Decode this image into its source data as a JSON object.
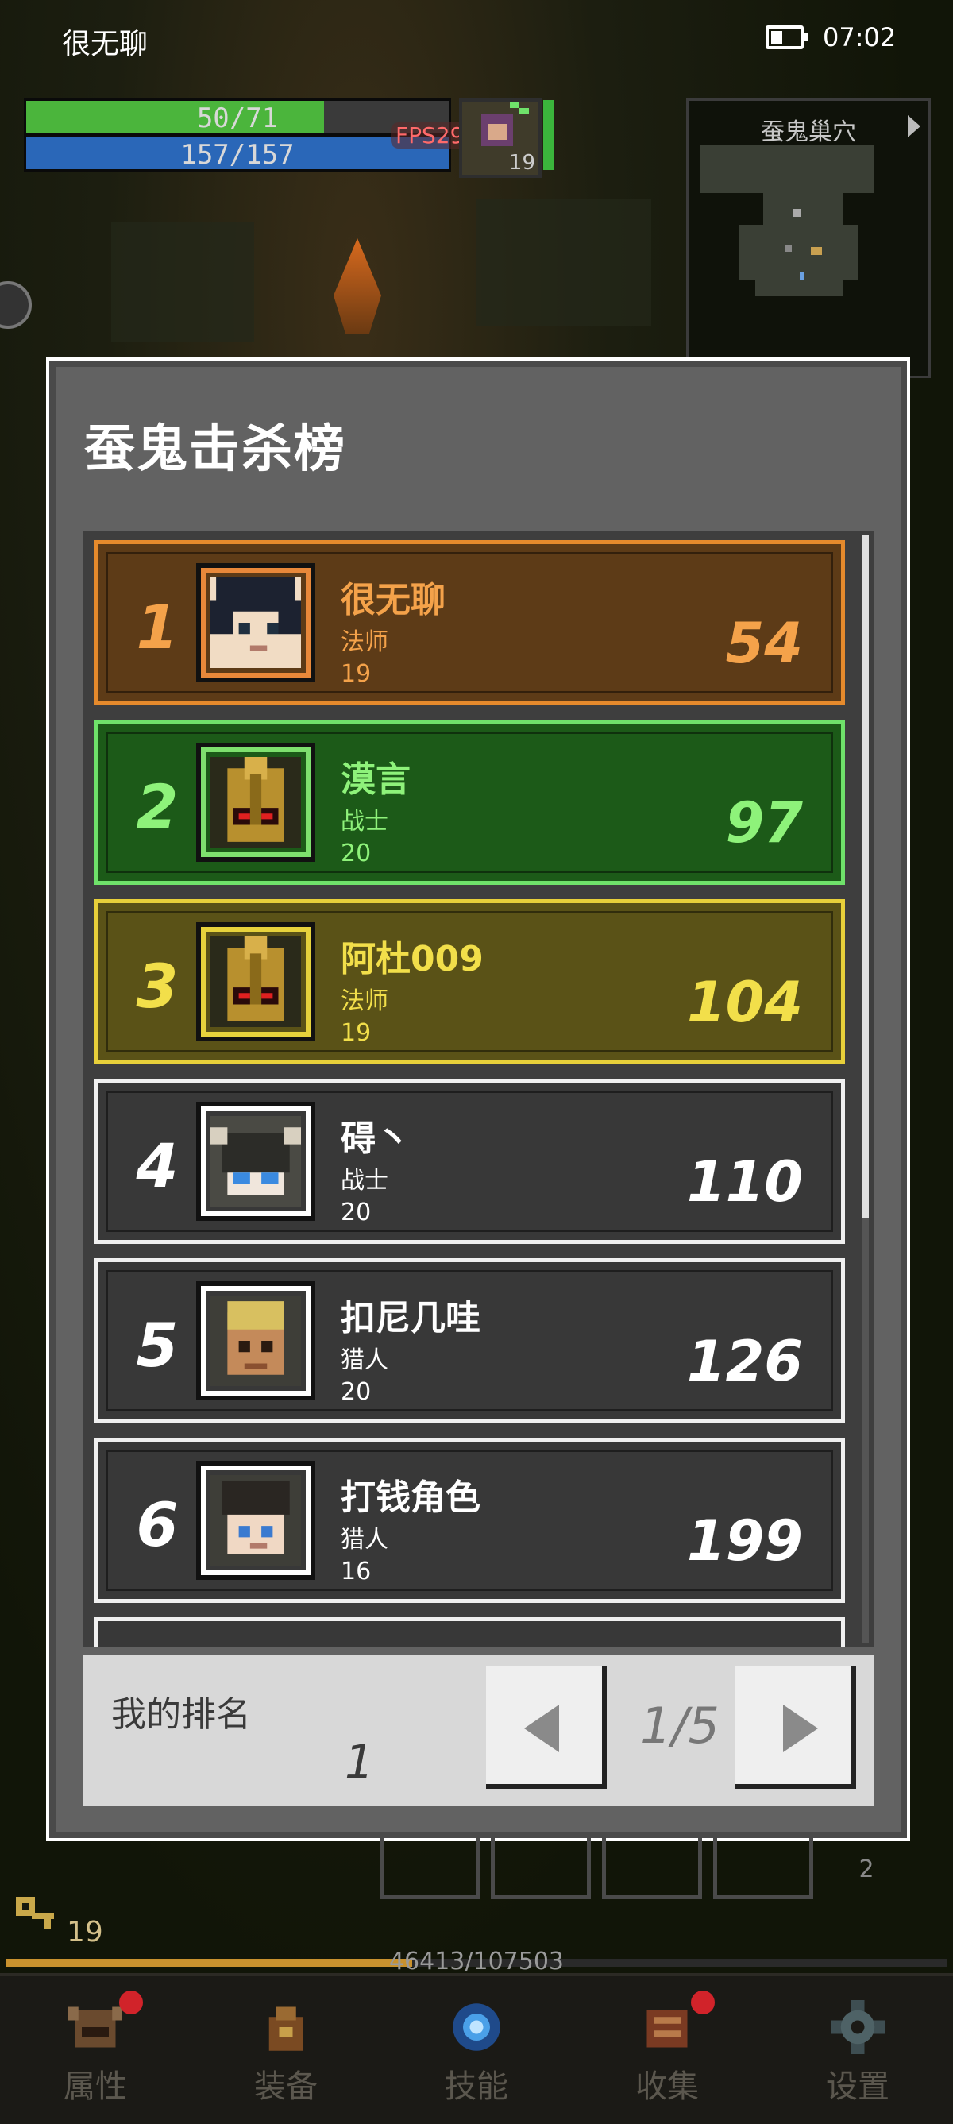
{
  "status_bar": {
    "title": "很无聊",
    "time": "07:02"
  },
  "hud": {
    "hp_text": "50/71",
    "hp_fraction": 0.704,
    "mp_text": "157/157",
    "fps_text": "FPS29",
    "pet_level": "19",
    "minimap_title": "蚕鬼巢穴"
  },
  "modal": {
    "title": "蚕鬼击杀榜",
    "rows": [
      {
        "rank": "1",
        "name": "很无聊",
        "class": "法师",
        "level": "19",
        "kills": "54",
        "avatar": "mage-boy"
      },
      {
        "rank": "2",
        "name": "漠言",
        "class": "战士",
        "level": "20",
        "kills": "97",
        "avatar": "gold-helmet"
      },
      {
        "rank": "3",
        "name": "阿杜009",
        "class": "法师",
        "level": "19",
        "kills": "104",
        "avatar": "gold-helmet"
      },
      {
        "rank": "4",
        "name": "碍丶",
        "class": "战士",
        "level": "20",
        "kills": "110",
        "avatar": "horned-helmet"
      },
      {
        "rank": "5",
        "name": "扣尼几哇",
        "class": "猎人",
        "level": "20",
        "kills": "126",
        "avatar": "blond-hunter"
      },
      {
        "rank": "6",
        "name": "打钱角色",
        "class": "猎人",
        "level": "16",
        "kills": "199",
        "avatar": "capped-hunter"
      }
    ],
    "my_rank_label": "我的排名",
    "my_rank_value": "1",
    "page_indicator": "1/5"
  },
  "bottom": {
    "slot_count": "2",
    "currency_value": "19",
    "xp_text": "46413/107503",
    "xp_fraction": 0.432
  },
  "nav": [
    {
      "label": "属性",
      "icon": "helmet-icon",
      "badge": true
    },
    {
      "label": "装备",
      "icon": "bag-icon",
      "badge": false
    },
    {
      "label": "技能",
      "icon": "skill-orb-icon",
      "badge": false
    },
    {
      "label": "收集",
      "icon": "book-icon",
      "badge": true
    },
    {
      "label": "设置",
      "icon": "gear-icon",
      "badge": false
    }
  ]
}
